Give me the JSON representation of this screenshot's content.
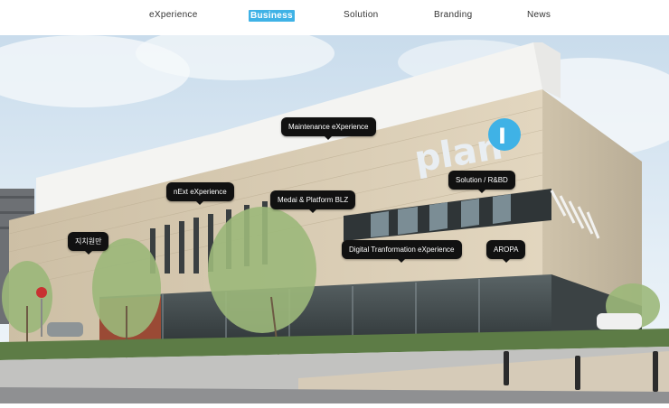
{
  "nav": {
    "items": [
      {
        "label": "eXperience",
        "active": false
      },
      {
        "label": "Business",
        "active": true
      },
      {
        "label": "Solution",
        "active": false
      },
      {
        "label": "Branding",
        "active": false
      },
      {
        "label": "News",
        "active": false
      }
    ],
    "active_color": "#3fb2e6"
  },
  "hero": {
    "logo_text": "plan",
    "logo_badge": "I",
    "tags": [
      {
        "label": "Maintenance eXperience"
      },
      {
        "label": "nExt eXperience"
      },
      {
        "label": "Medai & Platform BLZ"
      },
      {
        "label": "Solution / R&BD"
      },
      {
        "label": "지치원만"
      },
      {
        "label": "Digital Tranformation eXperience"
      },
      {
        "label": "AROPA"
      }
    ]
  }
}
